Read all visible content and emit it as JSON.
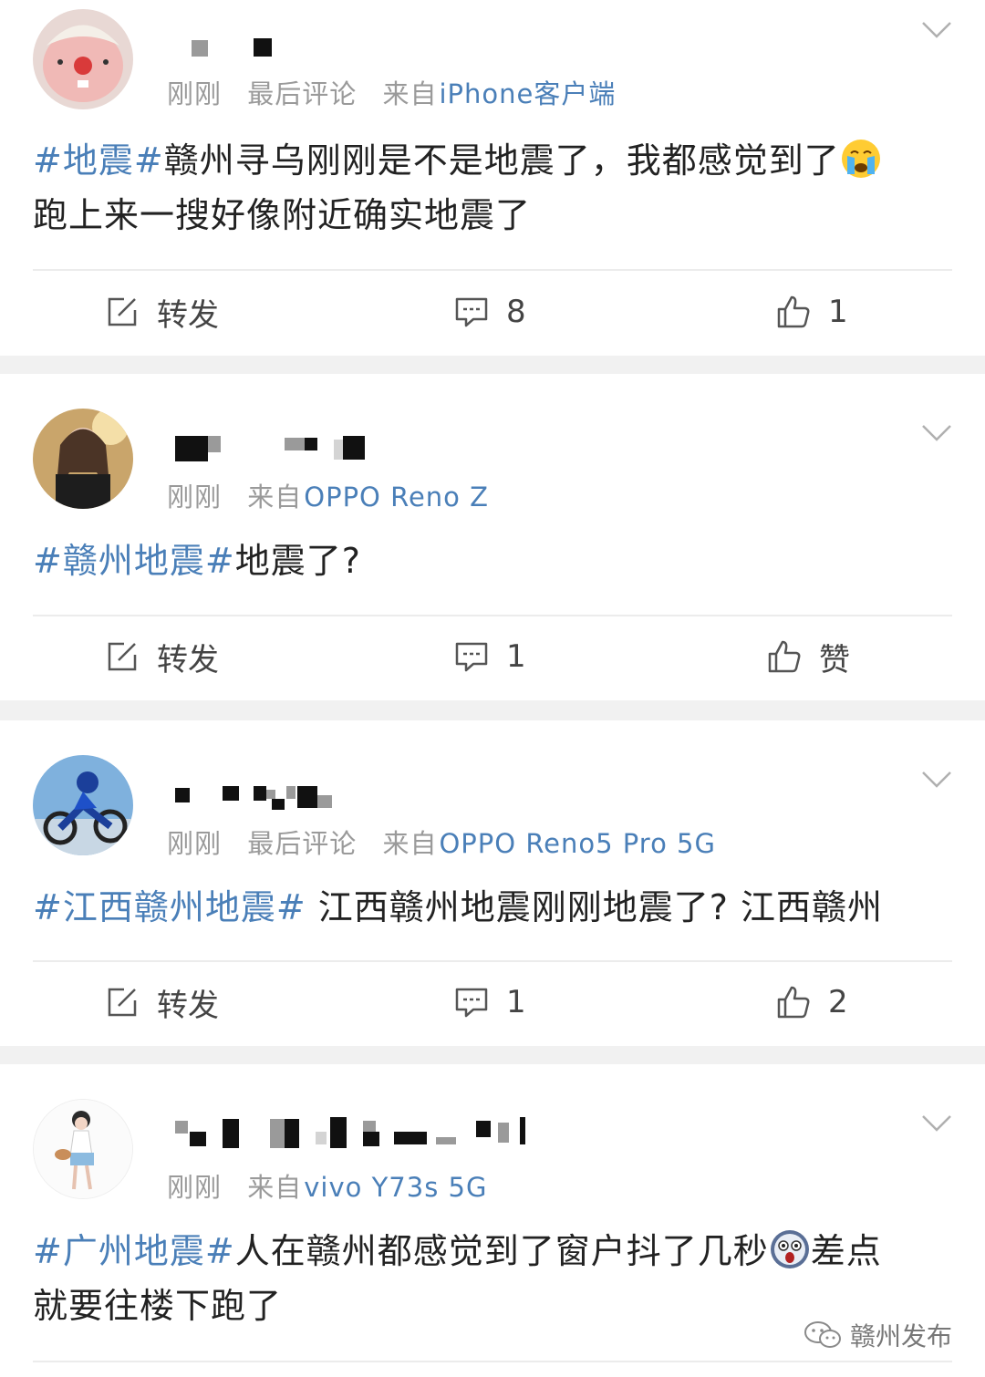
{
  "colors": {
    "link": "#4a7fb8",
    "meta": "#9a9a9a",
    "separator": "#f1f1f1"
  },
  "posts": [
    {
      "meta_time": "刚刚",
      "meta_extra": "最后评论",
      "meta_from": "来自",
      "meta_source": "iPhone客户端",
      "hashtag": "#地震#",
      "text_before_emoji": "赣州寻乌刚刚是不是地震了，我都感觉到了",
      "emoji": "crying-face",
      "text_after_emoji": "跑上来一搜好像附近确实地震了",
      "repost_label": "转发",
      "comment_count": "8",
      "like_label": "1"
    },
    {
      "meta_time": "刚刚",
      "meta_from": "来自",
      "meta_source": "OPPO Reno Z",
      "hashtag": "#赣州地震#",
      "text": "地震了?",
      "repost_label": "转发",
      "comment_count": "1",
      "like_label": "赞"
    },
    {
      "meta_time": "刚刚",
      "meta_extra": "最后评论",
      "meta_from": "来自",
      "meta_source": "OPPO Reno5 Pro 5G",
      "hashtag": "#江西赣州地震#",
      "text": " 江西赣州地震刚刚地震了? 江西赣州",
      "repost_label": "转发",
      "comment_count": "1",
      "like_label": "2"
    },
    {
      "meta_time": "刚刚",
      "meta_from": "来自",
      "meta_source": "vivo Y73s 5G",
      "hashtag": "#广州地震#",
      "text_before_emoji": "人在赣州都感觉到了窗户抖了几秒",
      "emoji": "shocked-face",
      "text_after_emoji_line1": "差点",
      "text_after_emoji": "就要往楼下跑了"
    }
  ],
  "watermark": "赣州发布"
}
